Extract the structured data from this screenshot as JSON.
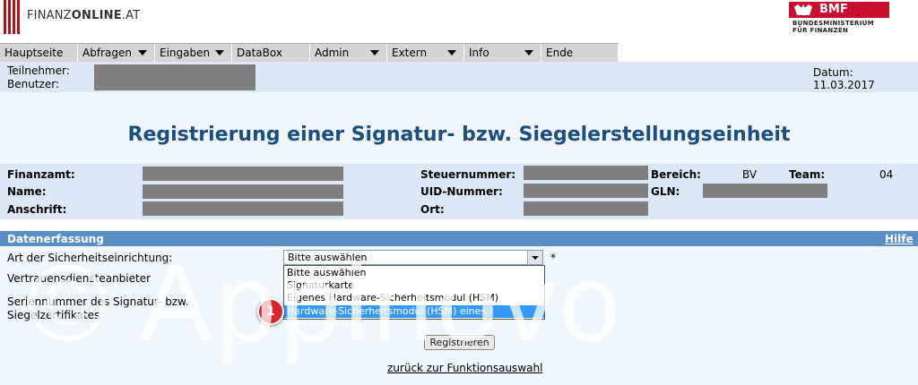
{
  "header": {
    "logo_brand_regular": "FINANZ",
    "logo_brand_bold": "ONLINE",
    "logo_brand_suffix": ".AT",
    "ministry_short": "BMF",
    "ministry_line1": "BUNDESMINISTERIUM",
    "ministry_line2": "FÜR FINANZEN"
  },
  "nav": {
    "items": [
      {
        "label": "Hauptseite",
        "has_menu": false
      },
      {
        "label": "Abfragen",
        "has_menu": true
      },
      {
        "label": "Eingaben",
        "has_menu": true
      },
      {
        "label": "DataBox",
        "has_menu": false
      },
      {
        "label": "Admin",
        "has_menu": true
      },
      {
        "label": "Extern",
        "has_menu": true
      },
      {
        "label": "Info",
        "has_menu": true
      },
      {
        "label": "Ende",
        "has_menu": false
      }
    ]
  },
  "session": {
    "teilnehmer_label": "Teilnehmer:",
    "benutzer_label": "Benutzer:",
    "datum_label": "Datum:",
    "datum_value": "11.03.2017"
  },
  "page_title": "Registrierung einer Signatur- bzw. Siegelerstellungseinheit",
  "taxpayer": {
    "finanzamt_label": "Finanzamt:",
    "name_label": "Name:",
    "anschrift_label": "Anschrift:",
    "steuernummer_label": "Steuernummer:",
    "uid_label": "UID-Nummer:",
    "ort_label": "Ort:",
    "bereich_label": "Bereich:",
    "bereich_value": "BV",
    "team_label": "Team:",
    "team_value": "04",
    "gln_label": "GLN:"
  },
  "section": {
    "title": "Datenerfassung",
    "help_link": "Hilfe"
  },
  "form": {
    "sicherheitseinrichtung_label": "Art der Sicherheitseinrichtung:",
    "vertrauensdiensteanbieter_label": "Vertrauensdiensteanbieter",
    "seriennummer_label_line1": "Seriennummer des Signatur- bzw.",
    "seriennummer_label_line2": "Siegelzertifikates:",
    "select_value": "Bitte auswählen",
    "required_marker": "*",
    "options": [
      "Bitte auswählen",
      "Signaturkarte",
      "Eigenes Hardware-Sicherheitsmodul (HSM)",
      "Hardware-Sicherheitsmodul (HSM) eines Dienstleisters"
    ],
    "highlighted_option_index": 3,
    "register_button": "Registrieren",
    "back_link": "zurück zur Funktionsauswahl"
  },
  "annotation": {
    "step_number": "1",
    "color": "#d9232d"
  },
  "watermark": "© Appinovo",
  "colors": {
    "title": "#1c4e80",
    "section_bar": "#5b8ec4",
    "band_light": "#dce8f5",
    "selection": "#3399ff",
    "brand_red": "#b5121b"
  }
}
